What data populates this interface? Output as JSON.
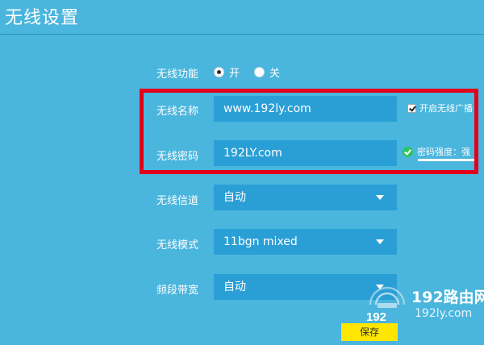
{
  "page": {
    "title": "无线设置"
  },
  "wireless_function": {
    "label": "无线功能",
    "on_label": "开",
    "off_label": "关",
    "selected": "开"
  },
  "ssid": {
    "label": "无线名称",
    "value": "www.192ly.com",
    "broadcast_label": "开启无线广播",
    "broadcast_checked": true
  },
  "password": {
    "label": "无线密码",
    "value": "192LY.com",
    "strength_text": "密码强度：强"
  },
  "channel": {
    "label": "无线信道",
    "value": "自动"
  },
  "mode": {
    "label": "无线模式",
    "value": "11bgn mixed"
  },
  "bandwidth": {
    "label": "频段带宽",
    "value": "自动"
  },
  "actions": {
    "save_label": "保存"
  },
  "watermark": {
    "name": "192路由网",
    "url": "192ly.com",
    "logo_text": "192"
  },
  "colors": {
    "background": "#4ab5dd",
    "field": "#2a9fd6",
    "highlight_frame": "#e3001b",
    "save_button": "#ffe600",
    "strength_ok": "#2ec45d"
  }
}
